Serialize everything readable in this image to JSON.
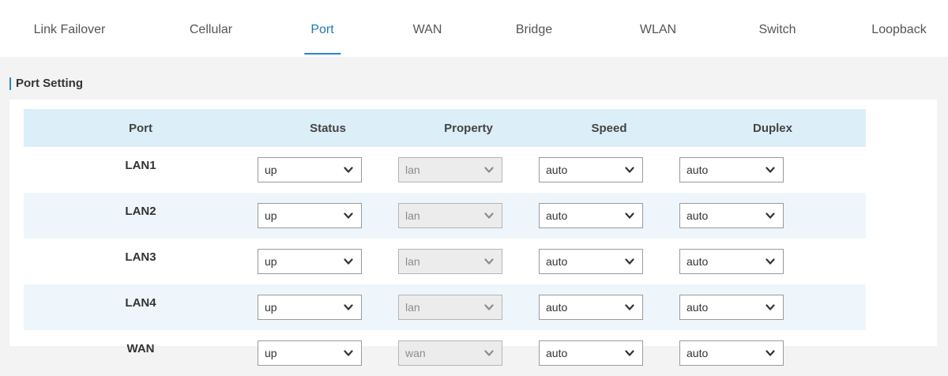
{
  "tabs": [
    {
      "label": "Link Failover",
      "active": false
    },
    {
      "label": "Cellular",
      "active": false
    },
    {
      "label": "Port",
      "active": true
    },
    {
      "label": "WAN",
      "active": false
    },
    {
      "label": "Bridge",
      "active": false
    },
    {
      "label": "WLAN",
      "active": false
    },
    {
      "label": "Switch",
      "active": false
    },
    {
      "label": "Loopback",
      "active": false
    }
  ],
  "section": {
    "title": "Port Setting"
  },
  "table": {
    "headers": {
      "port": "Port",
      "status": "Status",
      "property": "Property",
      "speed": "Speed",
      "duplex": "Duplex"
    },
    "rows": [
      {
        "port": "LAN1",
        "status": "up",
        "property": "lan",
        "speed": "auto",
        "duplex": "auto"
      },
      {
        "port": "LAN2",
        "status": "up",
        "property": "lan",
        "speed": "auto",
        "duplex": "auto"
      },
      {
        "port": "LAN3",
        "status": "up",
        "property": "lan",
        "speed": "auto",
        "duplex": "auto"
      },
      {
        "port": "LAN4",
        "status": "up",
        "property": "lan",
        "speed": "auto",
        "duplex": "auto"
      },
      {
        "port": "WAN",
        "status": "up",
        "property": "wan",
        "speed": "auto",
        "duplex": "auto"
      }
    ]
  },
  "colors": {
    "accent": "#2786c5",
    "header_bg": "#dceef8",
    "alt_row_bg": "#eef6fb"
  },
  "icons": {
    "dropdown": "chevron-down-icon"
  }
}
